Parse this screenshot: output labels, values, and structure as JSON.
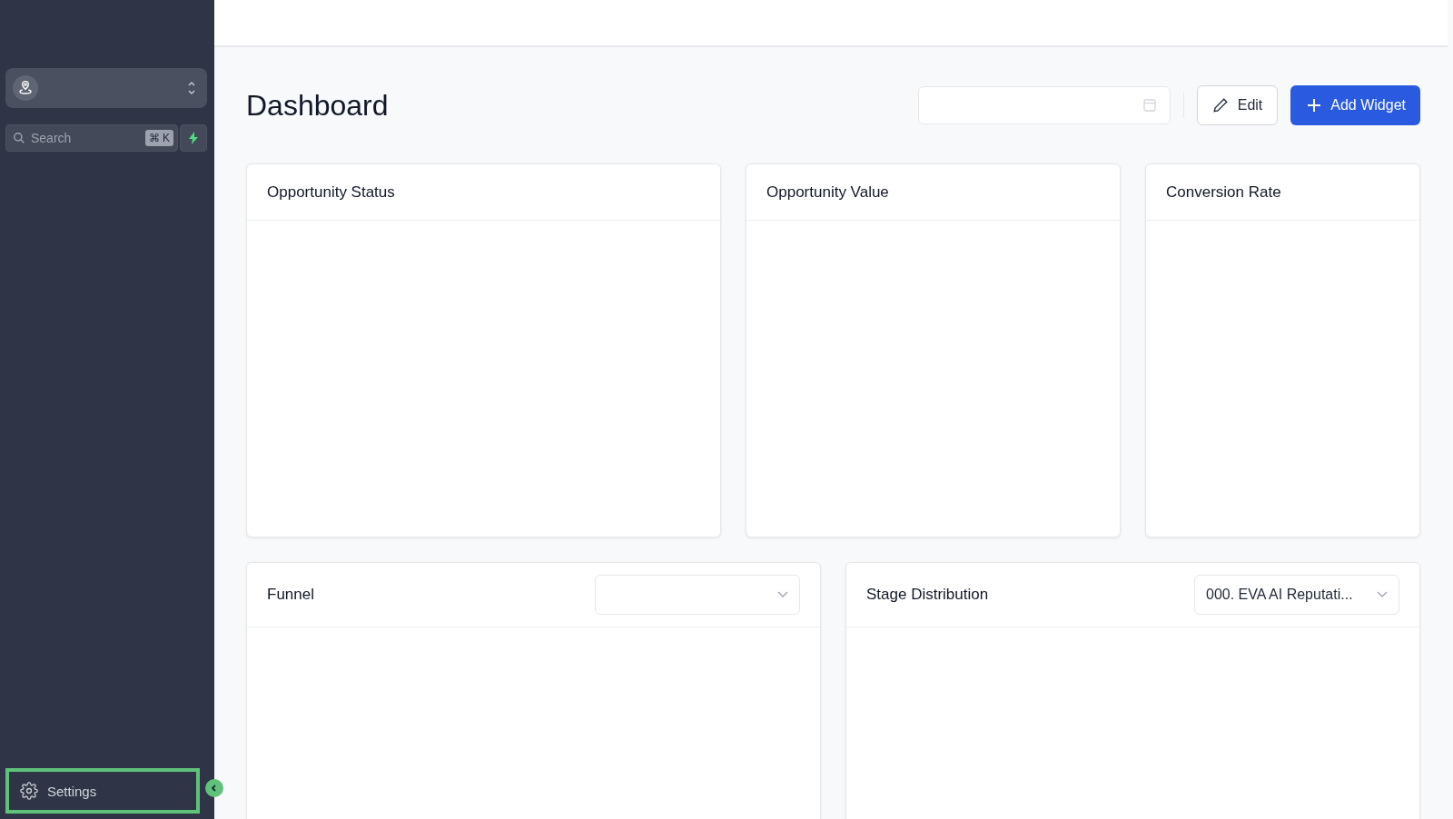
{
  "sidebar": {
    "search": {
      "placeholder": "Search",
      "shortcut": "⌘ K"
    },
    "footer_item": {
      "label": "Settings",
      "highlighted": true
    }
  },
  "header": {
    "title": "Dashboard",
    "date_picker": true,
    "buttons": [
      {
        "kind": "secondary",
        "label": "Edit"
      },
      {
        "kind": "primary",
        "label": "Add Widget"
      }
    ]
  },
  "widgets": [
    {
      "title": "Opportunity Status"
    },
    {
      "title": "Opportunity Value"
    },
    {
      "title": "Conversion Rate"
    },
    {
      "title": "Funnel",
      "has_dropdown": true
    },
    {
      "title": "Stage Distribution",
      "has_dropdown": true,
      "dropdown_value": "000. EVA AI Reputati..."
    }
  ]
}
